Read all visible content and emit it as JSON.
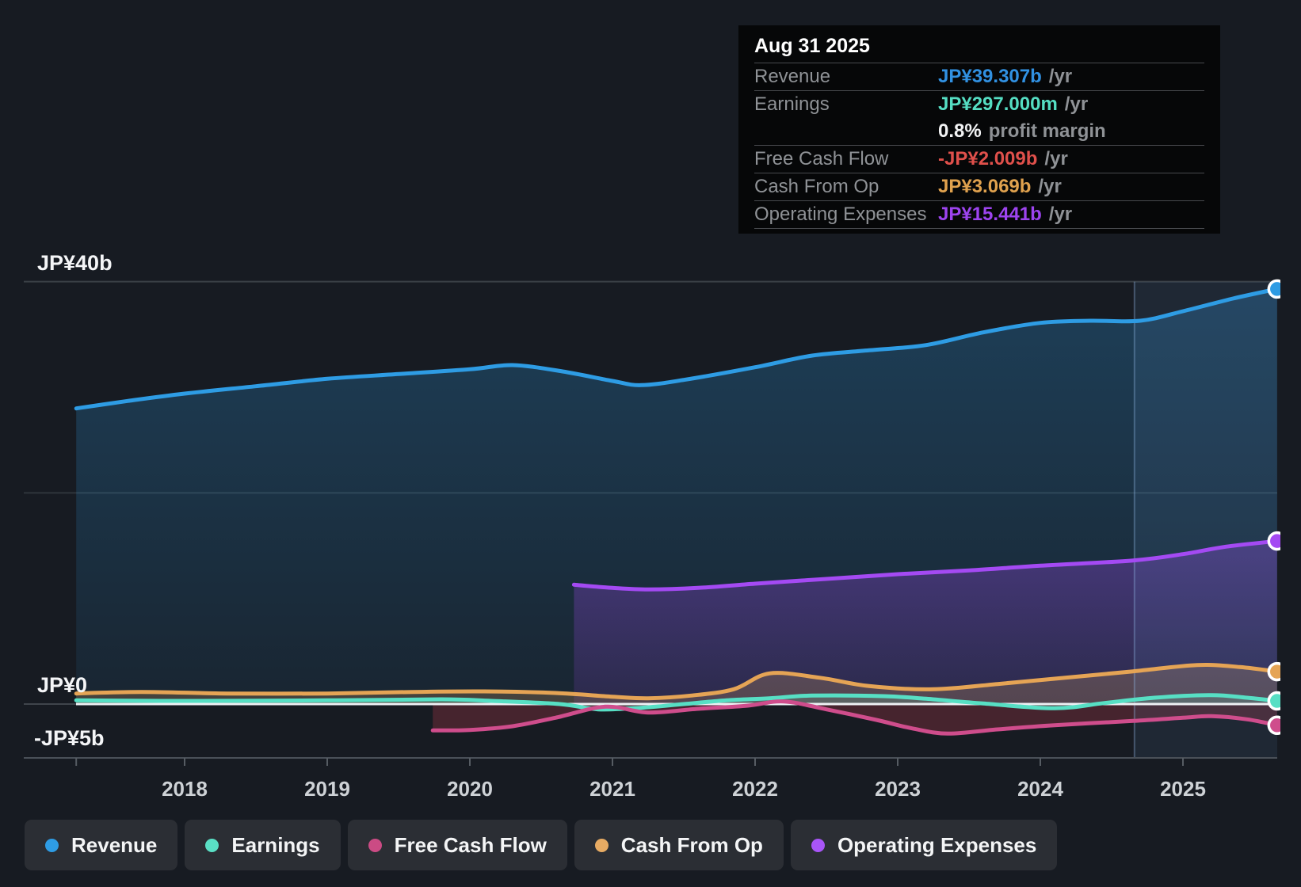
{
  "tooltip": {
    "date": "Aug 31 2025",
    "rows": [
      {
        "id": "revenue",
        "label": "Revenue",
        "value": "JP¥39.307b",
        "suffix": "/yr",
        "color": "#3191e2"
      },
      {
        "id": "earnings",
        "label": "Earnings",
        "value": "JP¥297.000m",
        "suffix": "/yr",
        "color": "#55dec3",
        "extra_value": "0.8%",
        "extra_label": "profit margin"
      },
      {
        "id": "free-cash-flow",
        "label": "Free Cash Flow",
        "value": "-JP¥2.009b",
        "suffix": "/yr",
        "color": "#e0504b"
      },
      {
        "id": "cash-from-op",
        "label": "Cash From Op",
        "value": "JP¥3.069b",
        "suffix": "/yr",
        "color": "#dfa14e"
      },
      {
        "id": "operating-expenses",
        "label": "Operating Expenses",
        "value": "JP¥15.441b",
        "suffix": "/yr",
        "color": "#9d44ef"
      }
    ]
  },
  "y_axis": {
    "top": "JP¥40b",
    "zero": "JP¥0",
    "bottom": "-JP¥5b"
  },
  "x_axis": {
    "labels": [
      "2018",
      "2019",
      "2020",
      "2021",
      "2022",
      "2023",
      "2024",
      "2025"
    ]
  },
  "legend": {
    "items": [
      {
        "id": "revenue",
        "label": "Revenue",
        "color": "#2e9ce4"
      },
      {
        "id": "earnings",
        "label": "Earnings",
        "color": "#5adfc5"
      },
      {
        "id": "free-cash-flow",
        "label": "Free Cash Flow",
        "color": "#cb4b84"
      },
      {
        "id": "cash-from-op",
        "label": "Cash From Op",
        "color": "#e7ab63"
      },
      {
        "id": "operating-expenses",
        "label": "Operating Expenses",
        "color": "#a855f7"
      }
    ]
  },
  "chart_data": {
    "type": "area",
    "x_unit": "decimal_year",
    "x_range": [
      2017.24,
      2025.66
    ],
    "ylim": [
      -5.1,
      40
    ],
    "y_gridlines_billions": [
      40,
      20,
      0,
      -5
    ],
    "y_gridline_labels": [
      "JP¥40b",
      "",
      "JP¥0",
      "-JP¥5b"
    ],
    "x_ticks": [
      2018,
      2019,
      2020,
      2021,
      2022,
      2023,
      2024,
      2025
    ],
    "highlight_band_x": [
      2024.66,
      2025.66
    ],
    "hover_date": "Aug 31 2025",
    "series": [
      {
        "id": "revenue",
        "name": "Revenue",
        "color": "#2e9ce4",
        "fill": "gradient-blue",
        "units": "JP¥ billions/yr",
        "points": [
          [
            2017.24,
            28.0
          ],
          [
            2017.6,
            28.7
          ],
          [
            2018.0,
            29.4
          ],
          [
            2018.5,
            30.1
          ],
          [
            2019.0,
            30.8
          ],
          [
            2019.5,
            31.25
          ],
          [
            2020.0,
            31.7
          ],
          [
            2020.3,
            32.1
          ],
          [
            2020.65,
            31.5
          ],
          [
            2021.0,
            30.6
          ],
          [
            2021.2,
            30.2
          ],
          [
            2021.5,
            30.7
          ],
          [
            2022.0,
            31.9
          ],
          [
            2022.4,
            33.0
          ],
          [
            2022.8,
            33.5
          ],
          [
            2023.2,
            34.0
          ],
          [
            2023.6,
            35.2
          ],
          [
            2024.0,
            36.1
          ],
          [
            2024.35,
            36.3
          ],
          [
            2024.7,
            36.3
          ],
          [
            2025.0,
            37.2
          ],
          [
            2025.35,
            38.4
          ],
          [
            2025.66,
            39.307
          ]
        ]
      },
      {
        "id": "operating-expenses",
        "name": "Operating Expenses",
        "color": "#a44af3",
        "fill": "gradient-purple",
        "units": "JP¥ billions/yr",
        "points": [
          [
            2020.73,
            11.3
          ],
          [
            2021.0,
            11.0
          ],
          [
            2021.25,
            10.85
          ],
          [
            2021.6,
            11.0
          ],
          [
            2022.0,
            11.4
          ],
          [
            2022.5,
            11.85
          ],
          [
            2023.0,
            12.3
          ],
          [
            2023.5,
            12.65
          ],
          [
            2024.0,
            13.1
          ],
          [
            2024.65,
            13.6
          ],
          [
            2025.0,
            14.2
          ],
          [
            2025.3,
            14.9
          ],
          [
            2025.66,
            15.441
          ]
        ]
      },
      {
        "id": "earnings",
        "name": "Earnings",
        "color": "#57dfc4",
        "fill": "rgba(90,223,197,0.20)",
        "units": "JP¥ billions/yr",
        "points": [
          [
            2017.24,
            0.35
          ],
          [
            2018.0,
            0.3
          ],
          [
            2019.0,
            0.35
          ],
          [
            2019.8,
            0.45
          ],
          [
            2020.15,
            0.3
          ],
          [
            2020.63,
            0.0
          ],
          [
            2020.9,
            -0.5
          ],
          [
            2021.2,
            -0.35
          ],
          [
            2021.5,
            0.0
          ],
          [
            2021.8,
            0.35
          ],
          [
            2022.1,
            0.55
          ],
          [
            2022.4,
            0.8
          ],
          [
            2022.9,
            0.75
          ],
          [
            2023.2,
            0.5
          ],
          [
            2023.6,
            0.05
          ],
          [
            2024.1,
            -0.4
          ],
          [
            2024.45,
            0.1
          ],
          [
            2024.8,
            0.6
          ],
          [
            2025.2,
            0.85
          ],
          [
            2025.45,
            0.6
          ],
          [
            2025.66,
            0.297
          ]
        ]
      },
      {
        "id": "cash-from-op",
        "name": "Cash From Op",
        "color": "#e5a455",
        "fill": "rgba(231,171,99,0.22)",
        "units": "JP¥ billions/yr",
        "points": [
          [
            2017.24,
            1.0
          ],
          [
            2017.7,
            1.15
          ],
          [
            2018.3,
            1.0
          ],
          [
            2019.0,
            1.0
          ],
          [
            2019.6,
            1.15
          ],
          [
            2020.1,
            1.2
          ],
          [
            2020.6,
            1.05
          ],
          [
            2021.0,
            0.7
          ],
          [
            2021.25,
            0.55
          ],
          [
            2021.55,
            0.8
          ],
          [
            2021.85,
            1.4
          ],
          [
            2022.1,
            2.9
          ],
          [
            2022.45,
            2.5
          ],
          [
            2022.8,
            1.7
          ],
          [
            2023.25,
            1.4
          ],
          [
            2023.7,
            1.9
          ],
          [
            2024.1,
            2.4
          ],
          [
            2024.65,
            3.1
          ],
          [
            2025.1,
            3.7
          ],
          [
            2025.4,
            3.5
          ],
          [
            2025.66,
            3.069
          ]
        ]
      },
      {
        "id": "free-cash-flow",
        "name": "Free Cash Flow",
        "color": "#cf4d8c",
        "fill": "rgba(205,60,80,0.26)",
        "units": "JP¥ billions/yr",
        "points": [
          [
            2019.74,
            -2.5
          ],
          [
            2020.0,
            -2.45
          ],
          [
            2020.3,
            -2.1
          ],
          [
            2020.6,
            -1.3
          ],
          [
            2020.95,
            -0.25
          ],
          [
            2021.25,
            -0.8
          ],
          [
            2021.6,
            -0.45
          ],
          [
            2021.95,
            -0.15
          ],
          [
            2022.2,
            0.25
          ],
          [
            2022.5,
            -0.5
          ],
          [
            2022.85,
            -1.5
          ],
          [
            2023.1,
            -2.3
          ],
          [
            2023.35,
            -2.8
          ],
          [
            2023.7,
            -2.4
          ],
          [
            2024.1,
            -2.0
          ],
          [
            2024.65,
            -1.6
          ],
          [
            2025.0,
            -1.3
          ],
          [
            2025.2,
            -1.15
          ],
          [
            2025.45,
            -1.45
          ],
          [
            2025.66,
            -2.009
          ]
        ]
      }
    ]
  }
}
